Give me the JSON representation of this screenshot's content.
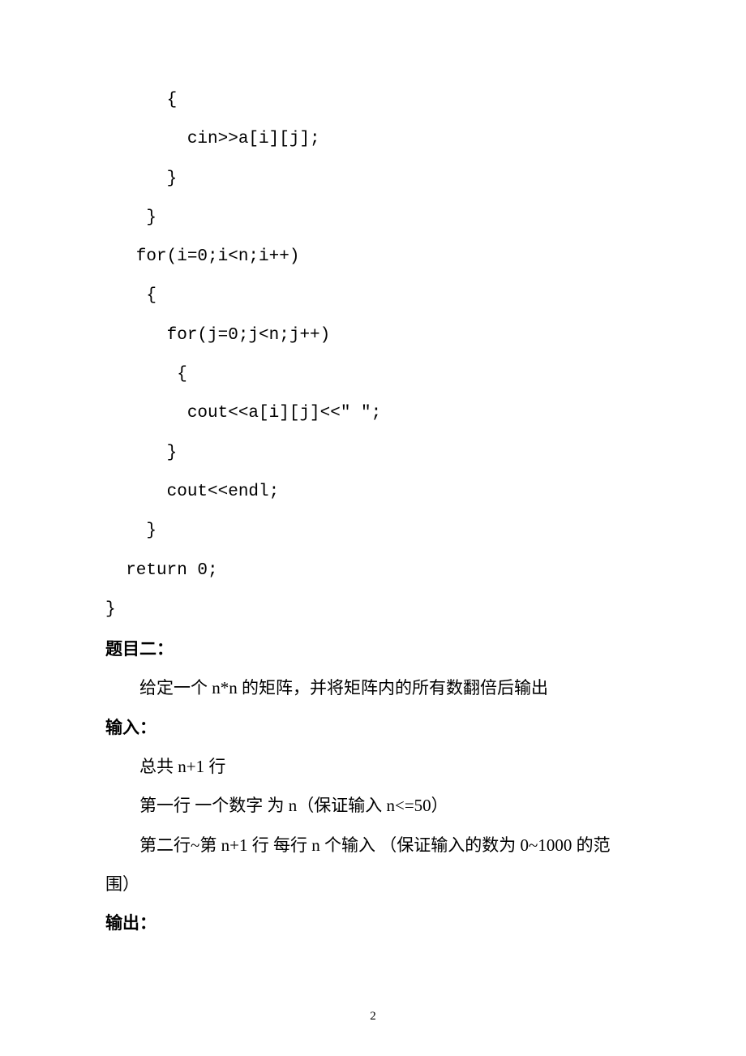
{
  "code": {
    "l1": "      {",
    "l2": "        cin>>a[i][j];",
    "l3": "      }",
    "l4": "    }",
    "l5": "   for(i=0;i<n;i++)",
    "l6": "    {",
    "l7": "      for(j=0;j<n;j++)",
    "l8": "       {",
    "l9": "        cout<<a[i][j]<<\" \";",
    "l10": "      }",
    "l11": "      cout<<endl;",
    "l12": "    }",
    "l13": "  return 0;",
    "l14": "}"
  },
  "headings": {
    "problem2": "题目二：",
    "input": "输入：",
    "output": "输出："
  },
  "prose": {
    "desc": "给定一个 n*n 的矩阵，并将矩阵内的所有数翻倍后输出",
    "in1": "总共 n+1 行",
    "in2": "第一行  一个数字 为 n（保证输入 n<=50）",
    "in3": "第二行~第 n+1 行    每行 n 个输入 （保证输入的数为 0~1000 的范",
    "in3b": "围）"
  },
  "page_number": "2"
}
